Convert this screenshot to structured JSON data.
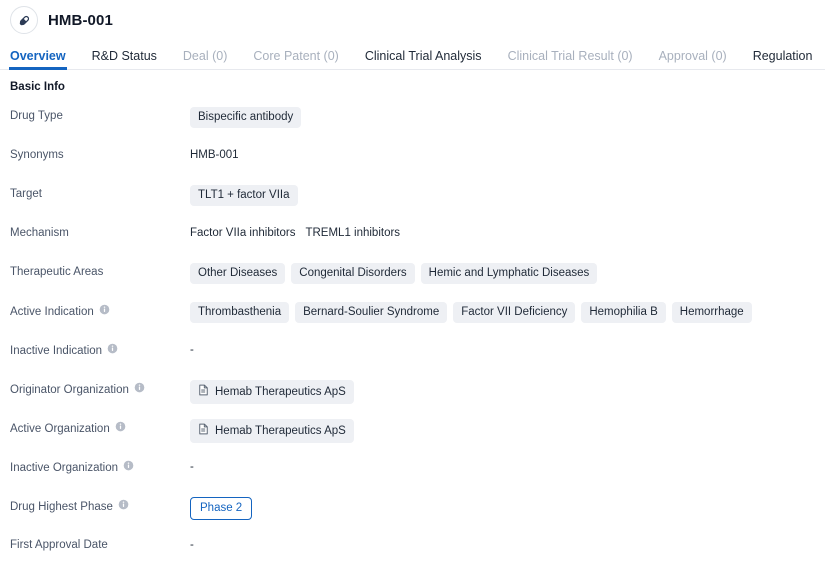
{
  "header": {
    "icon": "pill-capsule-icon",
    "title": "HMB-001"
  },
  "tabs": [
    {
      "label": "Overview",
      "state": "active"
    },
    {
      "label": "R&D Status",
      "state": "normal"
    },
    {
      "label": "Deal (0)",
      "state": "muted"
    },
    {
      "label": "Core Patent (0)",
      "state": "muted"
    },
    {
      "label": "Clinical Trial Analysis",
      "state": "normal"
    },
    {
      "label": "Clinical Trial Result (0)",
      "state": "muted"
    },
    {
      "label": "Approval (0)",
      "state": "muted"
    },
    {
      "label": "Regulation",
      "state": "normal"
    }
  ],
  "section": {
    "title": "Basic Info"
  },
  "fields": [
    {
      "label": "Drug Type",
      "info": false,
      "type": "chips",
      "values": [
        "Bispecific antibody"
      ]
    },
    {
      "label": "Synonyms",
      "info": false,
      "type": "text",
      "values": [
        "HMB-001"
      ]
    },
    {
      "label": "Target",
      "info": false,
      "type": "chips",
      "values": [
        "TLT1 + factor VIIa"
      ]
    },
    {
      "label": "Mechanism",
      "info": false,
      "type": "text",
      "values": [
        "Factor VIIa inhibitors",
        "TREML1 inhibitors"
      ]
    },
    {
      "label": "Therapeutic Areas",
      "info": false,
      "type": "chips",
      "values": [
        "Other Diseases",
        "Congenital Disorders",
        "Hemic and Lymphatic Diseases"
      ]
    },
    {
      "label": "Active Indication",
      "info": true,
      "type": "chips",
      "values": [
        "Thrombasthenia",
        "Bernard-Soulier Syndrome",
        "Factor VII Deficiency",
        "Hemophilia B",
        "Hemorrhage"
      ]
    },
    {
      "label": "Inactive Indication",
      "info": true,
      "type": "empty",
      "values": [
        "-"
      ]
    },
    {
      "label": "Originator Organization",
      "info": true,
      "type": "org-chips",
      "values": [
        "Hemab Therapeutics ApS"
      ]
    },
    {
      "label": "Active Organization",
      "info": true,
      "type": "org-chips",
      "values": [
        "Hemab Therapeutics ApS"
      ]
    },
    {
      "label": "Inactive Organization",
      "info": true,
      "type": "empty",
      "values": [
        "-"
      ]
    },
    {
      "label": "Drug Highest Phase",
      "info": true,
      "type": "phase",
      "values": [
        "Phase 2"
      ]
    },
    {
      "label": "First Approval Date",
      "info": false,
      "type": "empty",
      "values": [
        "-"
      ]
    }
  ],
  "colors": {
    "accent": "#1464c0",
    "chip_bg": "#eef0f4",
    "label_text": "#4a5568",
    "value_text": "#1f2937",
    "muted_tab": "#a8b0bd"
  }
}
